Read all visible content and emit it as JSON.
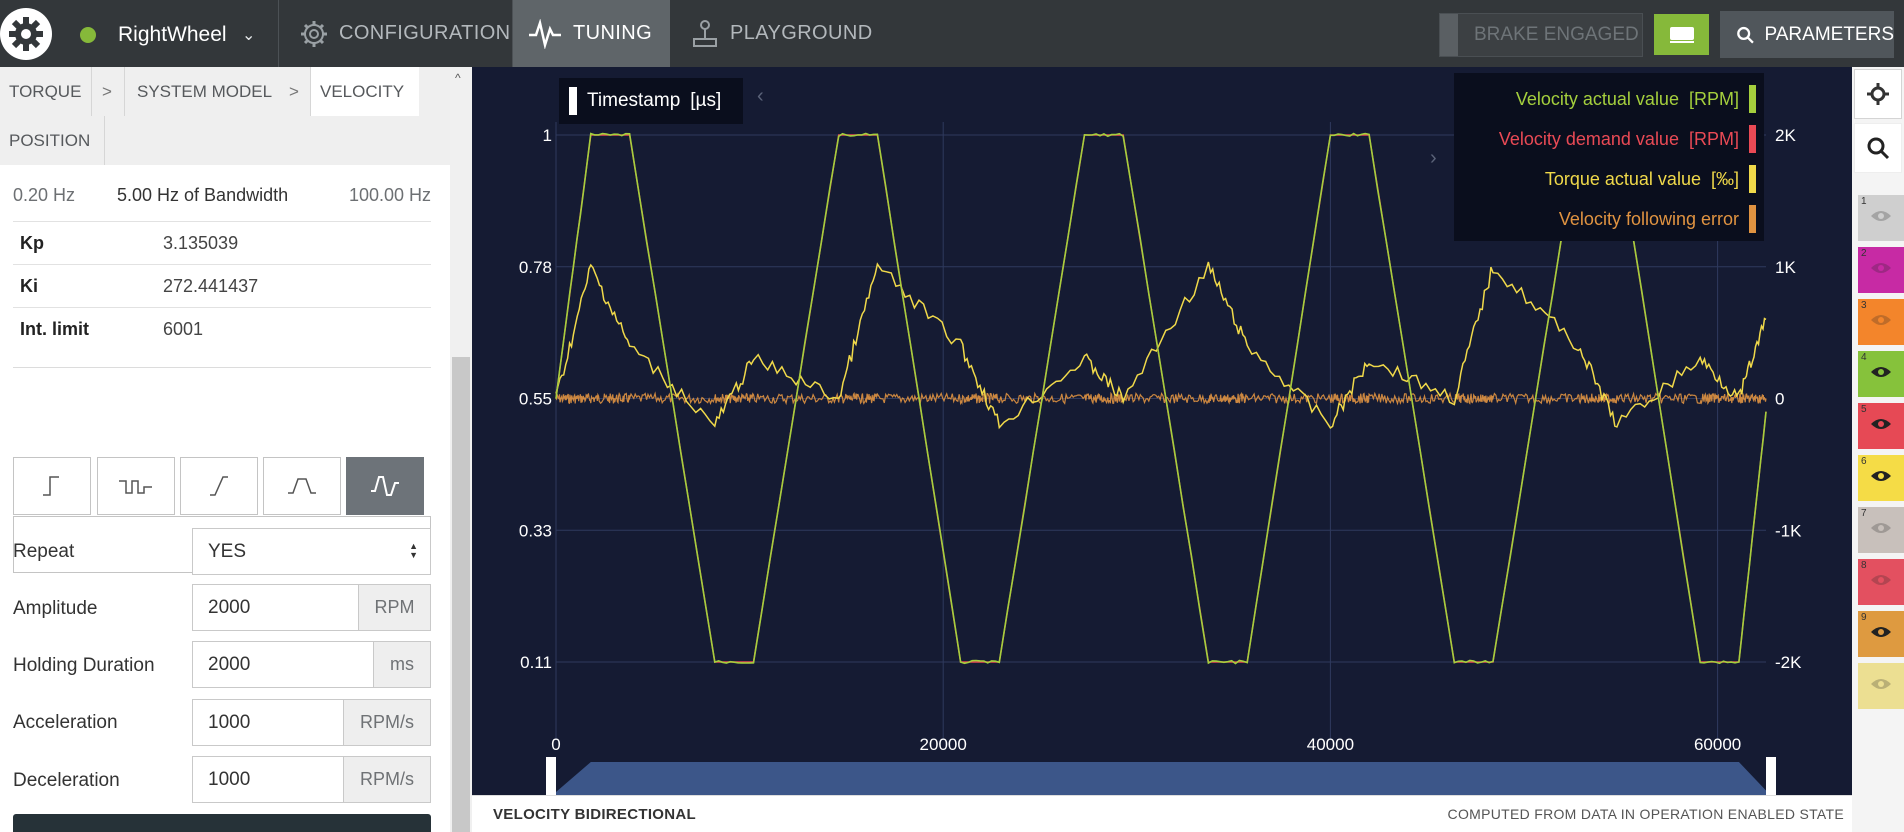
{
  "topbar": {
    "device_name": "RightWheel",
    "nav": [
      {
        "label": "CONFIGURATION",
        "icon": "gear-icon"
      },
      {
        "label": "TUNING",
        "icon": "waveform-icon"
      },
      {
        "label": "PLAYGROUND",
        "icon": "joystick-icon"
      }
    ],
    "brake_label": "BRAKE ENGAGED",
    "parameters_label": "PARAMETERS",
    "status_color": "#86b93a"
  },
  "tabs": {
    "torque": "TORQUE",
    "system_model": "SYSTEM MODEL",
    "velocity": "VELOCITY",
    "position": "POSITION",
    "separator": ">"
  },
  "bandwidth": {
    "min": "0.20 Hz",
    "value": "5.00 Hz of Bandwidth",
    "max": "100.00 Hz"
  },
  "gains": [
    {
      "key": "Kp",
      "value": "3.135039"
    },
    {
      "key": "Ki",
      "value": "272.441437"
    },
    {
      "key": "Int. limit",
      "value": "6001"
    }
  ],
  "waveforms": [
    "step-icon",
    "square-wave-icon",
    "ramp-icon",
    "trapezoid-icon",
    "trapezoid-bidirectional-icon",
    "sine-icon"
  ],
  "form": {
    "repeat": {
      "label": "Repeat",
      "value": "YES"
    },
    "amplitude": {
      "label": "Amplitude",
      "value": "2000",
      "unit": "RPM"
    },
    "holding": {
      "label": "Holding Duration",
      "value": "2000",
      "unit": "ms"
    },
    "acceleration": {
      "label": "Acceleration",
      "value": "1000",
      "unit": "RPM/s"
    },
    "deceleration": {
      "label": "Deceleration",
      "value": "1000",
      "unit": "RPM/s"
    }
  },
  "chart_controls": {
    "timestamp_label": "Timestamp",
    "timestamp_unit": "[µs]"
  },
  "chart_data": {
    "type": "line",
    "x": [
      0,
      1800,
      3800,
      8200,
      10200,
      14600,
      16600,
      20900,
      22900,
      27300,
      29300,
      33700,
      35700,
      40000,
      42000,
      46400,
      48400,
      52800,
      54800,
      59100,
      61100,
      62500
    ],
    "xticks": [
      "0",
      "20000",
      "40000",
      "60000"
    ],
    "xlim": [
      0,
      62500
    ],
    "yticks_left": [
      "1",
      "0.78",
      "0.55",
      "0.33",
      "0.11"
    ],
    "yticks_right": [
      "2K",
      "1K",
      "0",
      "-1K",
      "-2K"
    ],
    "ylim_right": [
      -2000,
      2000
    ],
    "series": [
      {
        "name": "Velocity actual value",
        "unit": "[RPM]",
        "color": "#a5cf3d",
        "values": [
          0,
          2000,
          2000,
          -2000,
          -2000,
          2000,
          2000,
          -2000,
          -2000,
          2000,
          2000,
          -2000,
          -2000,
          2000,
          2000,
          -2000,
          -2000,
          2000,
          2000,
          -2000,
          -2000,
          -100
        ]
      },
      {
        "name": "Velocity demand value",
        "unit": "[RPM]",
        "color": "#ea4a55",
        "values": [
          0,
          2000,
          2000,
          -2000,
          -2000,
          2000,
          2000,
          -2000,
          -2000,
          2000,
          2000,
          -2000,
          -2000,
          2000,
          2000,
          -2000,
          -2000,
          2000,
          2000,
          -2000,
          -2000,
          -100
        ]
      },
      {
        "name": "Torque actual value",
        "unit": "[‰]",
        "color": "#f0d94a",
        "values": [
          0,
          1000,
          400,
          -200,
          300,
          0,
          1000,
          400,
          -200,
          300,
          0,
          1000,
          400,
          -200,
          300,
          0,
          1000,
          400,
          -200,
          300,
          0,
          600
        ]
      },
      {
        "name": "Velocity following error",
        "unit": "",
        "color": "#e09341",
        "values": [
          0,
          0,
          0,
          0,
          0,
          0,
          0,
          0,
          0,
          0,
          0,
          0,
          0,
          0,
          0,
          0,
          0,
          0,
          0,
          0,
          0,
          0
        ]
      }
    ],
    "grid": true,
    "legend": "top-right"
  },
  "footer": {
    "title": "VELOCITY BIDIRECTIONAL",
    "note": "COMPUTED FROM DATA IN OPERATION ENABLED STATE"
  },
  "channels": [
    {
      "num": "1",
      "color": "#cfcfcf",
      "visible": false
    },
    {
      "num": "2",
      "color": "#c72aa4",
      "visible": false
    },
    {
      "num": "3",
      "color": "#f3852b",
      "visible": false
    },
    {
      "num": "4",
      "color": "#86c23b",
      "visible": true
    },
    {
      "num": "5",
      "color": "#e64955",
      "visible": true
    },
    {
      "num": "6",
      "color": "#f5dc46",
      "visible": true
    },
    {
      "num": "7",
      "color": "#c8c0bb",
      "visible": false
    },
    {
      "num": "8",
      "color": "#e35060",
      "visible": false
    },
    {
      "num": "9",
      "color": "#de9a40",
      "visible": true
    },
    {
      "num": "",
      "color": "#ecdf92",
      "visible": false
    }
  ]
}
